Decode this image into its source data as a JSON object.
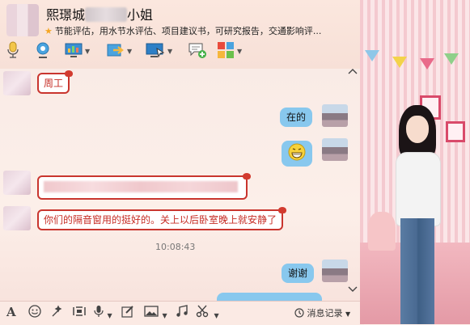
{
  "header": {
    "name_start": "熙璟城",
    "name_end": "小姐",
    "signature": "节能评估，用水节水评估、项目建议书，可研究报告，交通影响评...",
    "star_icon": "star-icon",
    "window_controls": [
      "pin-icon",
      "minimize-icon",
      "maximize-icon",
      "close-icon"
    ]
  },
  "toolbar": {
    "items": [
      "microphone-icon",
      "video-camera-icon",
      "remote-desktop-icon",
      "file-transfer-icon",
      "screen-share-icon",
      "create-discussion-icon",
      "apps-grid-icon"
    ]
  },
  "messages": [
    {
      "side": "left",
      "text": "周工"
    },
    {
      "side": "right",
      "text": "在的"
    },
    {
      "side": "right",
      "emoji": "grinning-face"
    },
    {
      "side": "left",
      "text": ""
    },
    {
      "side": "left",
      "text": "你们的隔音窗用的挺好的。关上以后卧室晚上就安静了"
    },
    {
      "side": "right",
      "text": "谢谢"
    }
  ],
  "timestamp": "10:08:43",
  "input_toolbar": {
    "items": [
      "font-icon",
      "emoji-icon",
      "magic-icon",
      "screenshot-icon",
      "voice-icon",
      "doodle-icon",
      "image-icon",
      "music-icon",
      "scissors-icon"
    ],
    "history_label": "消息记录"
  },
  "colors": {
    "bubble_right": "#88c8ee",
    "bubble_left_border": "#c9352e",
    "bubble_left_text": "#c62c24"
  }
}
